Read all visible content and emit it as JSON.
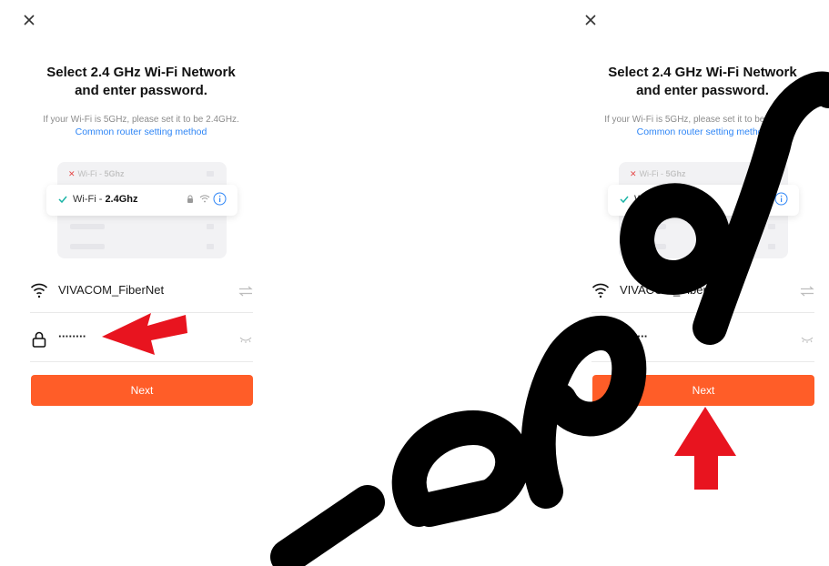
{
  "screen": {
    "title_line1": "Select 2.4 GHz Wi-Fi Network",
    "title_line2": "and enter password.",
    "subtitle": "If your Wi-Fi is 5GHz, please set it to be 2.4GHz.",
    "link": "Common router setting method",
    "illustration": {
      "row_5ghz_prefix": "Wi-Fi - ",
      "row_5ghz_band": "5Ghz",
      "row_24_prefix": "Wi-Fi - ",
      "row_24_band": "2.4Ghz"
    },
    "ssid": "VIVACOM_FiberNet",
    "password_masked": "········",
    "next_label": "Next"
  },
  "icons": {
    "close": "close-icon",
    "wifi": "wifi-icon",
    "lock": "lock-icon",
    "swap": "swap-icon",
    "eye": "eye-closed-icon",
    "info": "info-icon",
    "check": "check-icon"
  },
  "colors": {
    "accent": "#ff5d28",
    "link": "#2f86f6",
    "check": "#1bb4a6",
    "error": "#e54848",
    "annotation_arrow": "#e8141f"
  }
}
